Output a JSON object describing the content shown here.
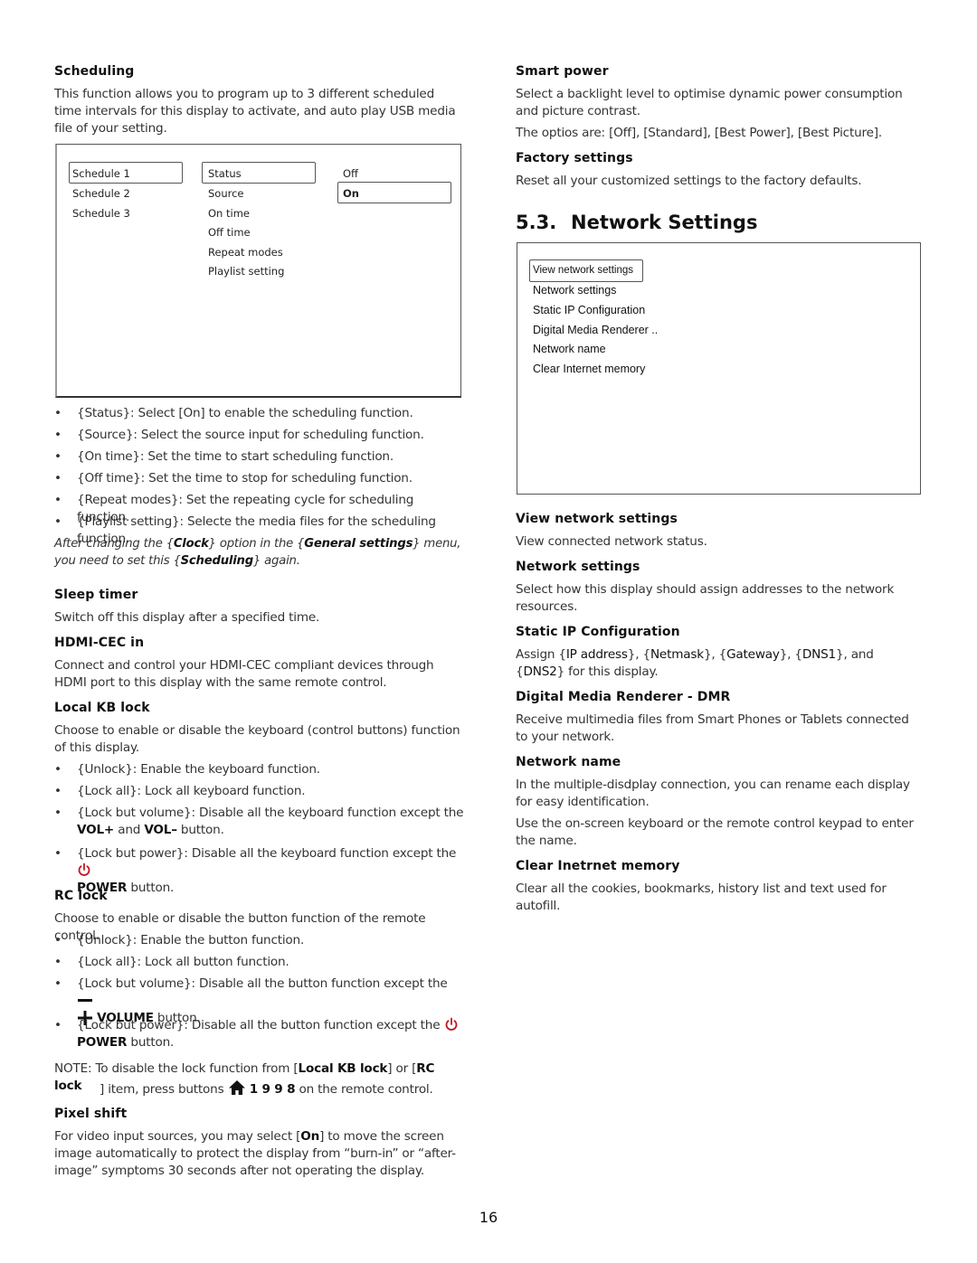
{
  "left": {
    "scheduling": {
      "heading": "Scheduling",
      "intro": "This function allows you to program up to 3 different scheduled time intervals for this display to activate, and auto play USB media file of your setting.",
      "menu": {
        "schedules": [
          "Schedule 1",
          "Schedule 2",
          "Schedule 3"
        ],
        "selected_schedule": "Schedule 1",
        "options": [
          "Status",
          "Source",
          "On time",
          "Off time",
          "Repeat modes",
          "Playlist setting"
        ],
        "selected_option": "Status",
        "values": [
          "Off",
          "On"
        ],
        "selected_value": "On"
      },
      "bullets": [
        {
          "term": "Status",
          "text": ": Select [On] to enable the scheduling function."
        },
        {
          "term": "Source",
          "text": ": Select the source input for scheduling function."
        },
        {
          "term": "On time",
          "text": ": Set the time to start scheduling function."
        },
        {
          "term": "Off time",
          "text": ": Set the time to stop for scheduling function."
        },
        {
          "term": "Repeat modes",
          "text": ": Set the repeating cycle for scheduling function."
        },
        {
          "term": "Playlist setting",
          "text": ": Selecte the media files for the scheduling function."
        }
      ],
      "note": {
        "p1": "After changing the ",
        "t1": "Clock",
        "p2": " option in the ",
        "t2": "General settings",
        "p3": " menu, you need to set this ",
        "t3": "Scheduling",
        "p4": " again."
      }
    },
    "sleep_timer": {
      "heading": "Sleep timer",
      "text": "Switch off this display after a specified time."
    },
    "hdmi_cec": {
      "heading": "HDMI-CEC in",
      "text": "Connect and control your HDMI-CEC compliant devices through HDMI port to this display with the same remote control."
    },
    "local_kb_lock": {
      "heading": "Local KB lock",
      "text": "Choose to enable or disable the keyboard (control buttons) function of this display.",
      "bullets": [
        {
          "term": "Unlock",
          "text": ": Enable the keyboard function."
        },
        {
          "term": "Lock all",
          "text": ": Lock all keyboard function."
        },
        {
          "term": "Lock but volume",
          "text": ": Disable all the keyboard function except the ",
          "k1": "VOL+",
          "mid": " and ",
          "k2": "VOL–",
          "end": " button."
        },
        {
          "term": "Lock but power",
          "text": ": Disable all the keyboard function except the ",
          "k1": "POWER",
          "end": " button."
        }
      ]
    },
    "rc_lock": {
      "heading": "RC lock",
      "text": "Choose to enable or disable the button function of the remote control.",
      "bullets": [
        {
          "term": "Unlock",
          "text": ": Enable the button function."
        },
        {
          "term": "Lock all",
          "text": ": Lock all button function."
        },
        {
          "term": "Lock but volume",
          "text": ": Disable all the button function except the ",
          "k1": "VOLUME",
          "end": " button."
        },
        {
          "term": "Lock but power",
          "text": ": Disable all the button function except the ",
          "k1": "POWER",
          "end": " button."
        }
      ]
    },
    "note": {
      "label": "NOTE:",
      "p1": " To disable the lock function from [",
      "t1": "Local KB lock",
      "p2": "] or [",
      "t2": "RC lock",
      "p3": "] item, press buttons ",
      "keys": "1 9 9 8",
      "p4": " on the remote control."
    },
    "pixel_shift": {
      "heading": "Pixel shift",
      "p1": "For video input sources, you may select [",
      "t1": "On",
      "p2": "] to move the screen image automatically to protect the display from “burn-in” or “after-image” symptoms 30 seconds after not operating the display."
    }
  },
  "right": {
    "smart_power": {
      "heading": "Smart power",
      "text": "Select a backlight level to optimise dynamic power consumption and picture contrast.",
      "options_prefix": "The optios are: ",
      "options": [
        "Off",
        "Standard",
        "Best Power",
        "Best Picture"
      ]
    },
    "factory_settings": {
      "heading": "Factory settings",
      "text": "Reset all your customized settings to the factory defaults."
    },
    "network_section": {
      "number": "5.3.",
      "title": "Network Settings",
      "menu": {
        "items": [
          "View network settings",
          "Network settings",
          "Static IP Configuration",
          "Digital Media Renderer ..",
          "Network name",
          "Clear Internet memory"
        ],
        "selected": "View network settings"
      }
    },
    "view_network_settings": {
      "heading": "View network settings",
      "text": "View connected network status."
    },
    "network_settings": {
      "heading": "Network settings",
      "text": "Select how this display should assign addresses to the network resources."
    },
    "static_ip": {
      "heading": "Static IP Configuration",
      "p1": "Assign {",
      "t1": "IP address",
      "p2": "}, {",
      "t2": "Netmask",
      "p3": "}, {",
      "t3": "Gateway",
      "p4": "}, {",
      "t4": "DNS1",
      "p5": "}, and {",
      "t5": "DNS2",
      "p6": "} for this display."
    },
    "dmr": {
      "heading": "Digital Media Renderer - DMR",
      "text": "Receive multimedia files from Smart Phones or Tablets connected to your network."
    },
    "network_name": {
      "heading": "Network name",
      "text1": "In the multiple-disdplay connection, you can rename each display for easy identification.",
      "text2": "Use the on-screen keyboard or the remote control keypad to enter the name."
    },
    "clear_memory": {
      "heading": "Clear Inetrnet memory",
      "text": "Clear all the cookies, bookmarks, history list and text used for autofill."
    }
  },
  "icons": {
    "power": "power-icon",
    "volume_minus": "minus-icon",
    "volume_plus": "plus-icon",
    "home": "home-icon"
  },
  "colors": {
    "power_icon": "#c0191f",
    "text": "#333333",
    "heading": "#111111"
  },
  "page_number": "16"
}
